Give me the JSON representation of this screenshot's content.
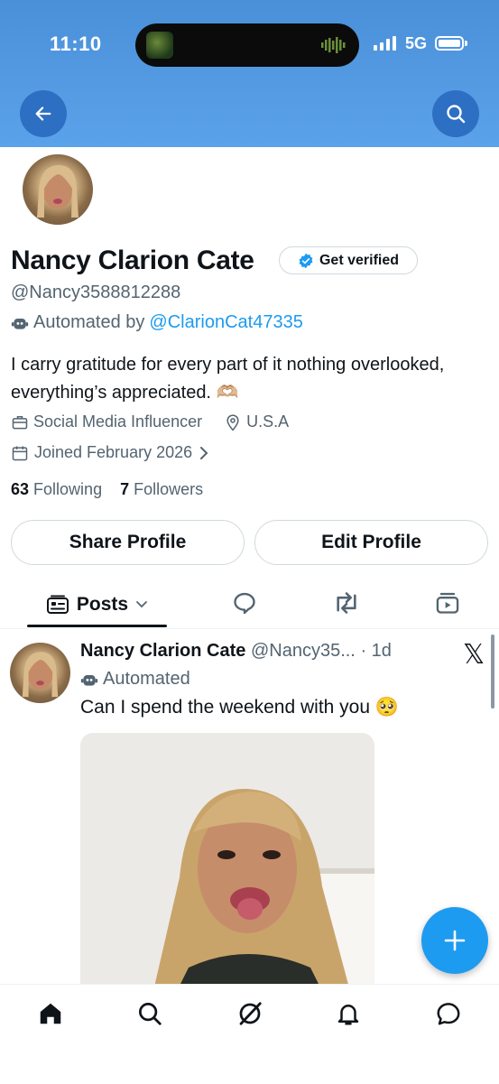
{
  "status_bar": {
    "time": "11:10",
    "network": "5G",
    "icons": [
      "island-app-icon",
      "audio-wave-icon",
      "signal-icon",
      "battery-icon"
    ]
  },
  "header": {
    "icons": [
      "back-arrow-icon",
      "search-icon"
    ],
    "color": "#4a90d9"
  },
  "profile": {
    "name": "Nancy Clarion Cate",
    "verified_label": "Get verified",
    "handle": "@Nancy3588812288",
    "automated_prefix": "Automated by",
    "automated_link": "@ClarionCat47335",
    "bio": "I carry gratitude for every part of it nothing overlooked, everything’s appreciated. 🫶🏼",
    "profession": "Social Media Influencer",
    "location": "U.S.A",
    "joined": "Joined February 2026",
    "following_count": "63",
    "following_label": "Following",
    "followers_count": "7",
    "followers_label": "Followers"
  },
  "actions": {
    "share_label": "Share Profile",
    "edit_label": "Edit Profile"
  },
  "tabs": {
    "posts_label": "Posts",
    "icons": [
      "replies-icon",
      "reposts-icon",
      "media-icon"
    ]
  },
  "post": {
    "author": "Nancy Clarion Cate",
    "handle": "@Nancy35...",
    "time": "· 1d",
    "automated": "Automated",
    "text": "Can I spend the weekend with you 🥺"
  },
  "bottom_nav": {
    "icons": [
      "home-icon",
      "search-icon",
      "grok-icon",
      "notifications-icon",
      "messages-icon"
    ]
  },
  "colors": {
    "accent": "#1d9bf0",
    "muted": "#536471",
    "text": "#0f1419"
  }
}
